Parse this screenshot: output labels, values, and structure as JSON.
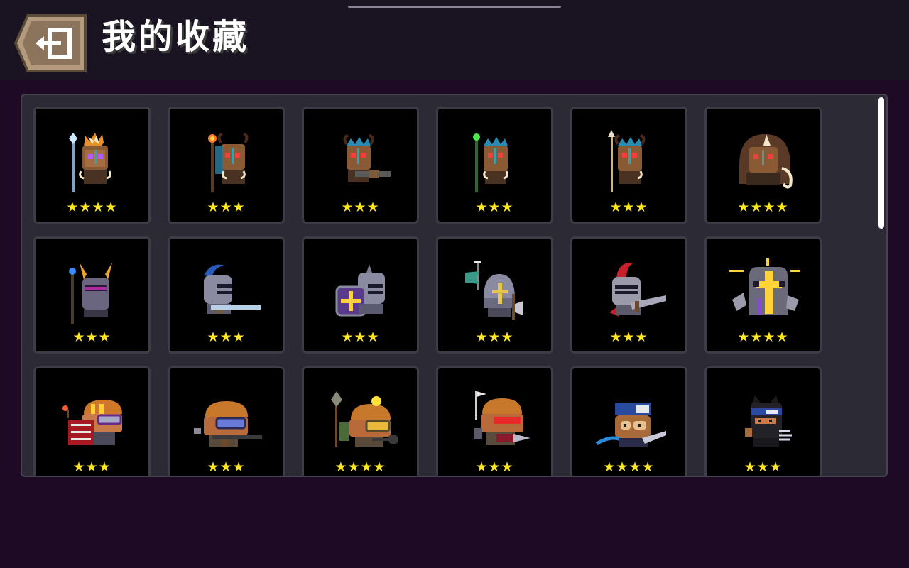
{
  "header": {
    "title": "我的收藏",
    "back_icon": "exit-door-icon"
  },
  "colors": {
    "background": "#1f0a26",
    "topbar": "#1a1422",
    "panel": "#2b2a35",
    "card": "#000000",
    "card_border": "#3d3c47",
    "star": "#ffe820"
  },
  "collection": [
    {
      "name": "druid-staff-frost",
      "rarity": 4,
      "stars": "★★★★"
    },
    {
      "name": "druid-staff-fire",
      "rarity": 3,
      "stars": "★★★"
    },
    {
      "name": "druid-shotgun",
      "rarity": 3,
      "stars": "★★★"
    },
    {
      "name": "druid-staff-green",
      "rarity": 3,
      "stars": "★★★"
    },
    {
      "name": "druid-spear",
      "rarity": 3,
      "stars": "★★★"
    },
    {
      "name": "druid-hooded-horn",
      "rarity": 4,
      "stars": "★★★★"
    },
    {
      "name": "paladin-winged-helm",
      "rarity": 3,
      "stars": "★★★"
    },
    {
      "name": "paladin-blue-plume-rifle",
      "rarity": 3,
      "stars": "★★★"
    },
    {
      "name": "paladin-cross-shield",
      "rarity": 3,
      "stars": "★★★"
    },
    {
      "name": "paladin-banner-axe",
      "rarity": 3,
      "stars": "★★★"
    },
    {
      "name": "paladin-red-plume-sword",
      "rarity": 3,
      "stars": "★★★"
    },
    {
      "name": "paladin-golden-cross",
      "rarity": 4,
      "stars": "★★★★"
    },
    {
      "name": "engineer-dynamite",
      "rarity": 3,
      "stars": "★★★"
    },
    {
      "name": "engineer-goggles-rifle",
      "rarity": 3,
      "stars": "★★★"
    },
    {
      "name": "engineer-miner-shovel",
      "rarity": 4,
      "stars": "★★★★"
    },
    {
      "name": "engineer-red-visor-drill",
      "rarity": 3,
      "stars": "★★★"
    },
    {
      "name": "assassin-monkey-blades",
      "rarity": 4,
      "stars": "★★★★"
    },
    {
      "name": "assassin-black-cat-claws",
      "rarity": 3,
      "stars": "★★★"
    }
  ]
}
